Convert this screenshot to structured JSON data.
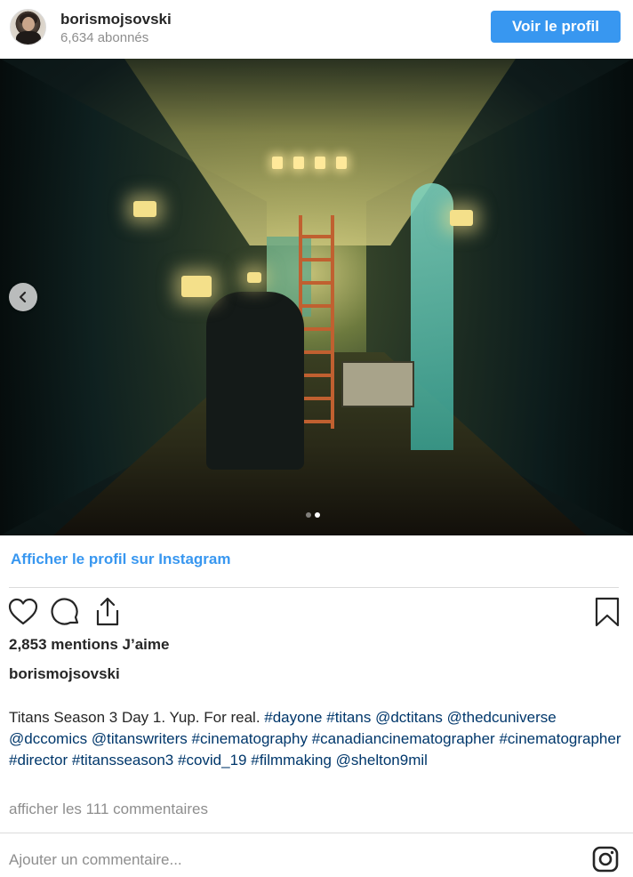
{
  "header": {
    "username": "borismojsovski",
    "followers": "6,634 abonnés",
    "profile_button": "Voir le profil"
  },
  "carousel": {
    "total": 2,
    "active_index": 1
  },
  "links": {
    "view_on_instagram": "Afficher le profil sur Instagram"
  },
  "post": {
    "likes": "2,853 mentions J’aime",
    "caption_user": "borismojsovski",
    "caption_parts": [
      {
        "text": "Titans Season 3 Day 1. Yup. For real. ",
        "link": false
      },
      {
        "text": "#dayone",
        "link": true
      },
      {
        "text": " ",
        "link": false
      },
      {
        "text": "#titans",
        "link": true
      },
      {
        "text": " ",
        "link": false
      },
      {
        "text": "@dctitans",
        "link": true
      },
      {
        "text": " ",
        "link": false
      },
      {
        "text": "@thedcuniverse",
        "link": true
      },
      {
        "text": " ",
        "link": false
      },
      {
        "text": "@dccomics",
        "link": true
      },
      {
        "text": " ",
        "link": false
      },
      {
        "text": "@titanswriters",
        "link": true
      },
      {
        "text": " ",
        "link": false
      },
      {
        "text": "#cinematography",
        "link": true
      },
      {
        "text": " ",
        "link": false
      },
      {
        "text": "#canadiancinematographer",
        "link": true
      },
      {
        "text": " ",
        "link": false
      },
      {
        "text": "#cinematographer",
        "link": true
      },
      {
        "text": " ",
        "link": false
      },
      {
        "text": "#director",
        "link": true
      },
      {
        "text": " ",
        "link": false
      },
      {
        "text": "#titansseason3",
        "link": true
      },
      {
        "text": " ",
        "link": false
      },
      {
        "text": "#covid_19",
        "link": true
      },
      {
        "text": " ",
        "link": false
      },
      {
        "text": "#filmmaking",
        "link": true
      },
      {
        "text": " ",
        "link": false
      },
      {
        "text": "@shelton9mil",
        "link": true
      }
    ],
    "view_comments": "afficher les 111 commentaires"
  },
  "comment": {
    "placeholder": "Ajouter un commentaire..."
  },
  "colors": {
    "accent": "#3897f0",
    "link": "#00376b",
    "muted": "#8e8e8e",
    "text": "#262626"
  },
  "icons": [
    "heart-icon",
    "comment-icon",
    "share-icon",
    "bookmark-icon",
    "chevron-left-icon",
    "instagram-icon"
  ]
}
